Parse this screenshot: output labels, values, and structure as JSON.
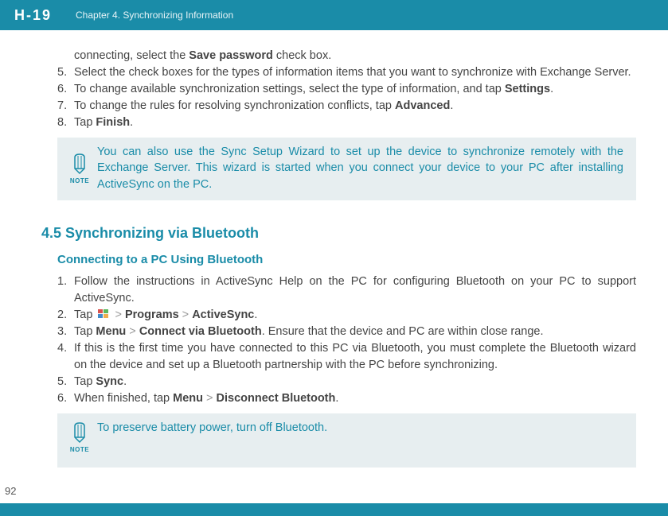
{
  "header": {
    "logo": "H-19",
    "chapter": "Chapter 4. Synchronizing Information"
  },
  "page_number": "92",
  "intro_line_prefix": "connecting, select the ",
  "intro_line_bold": "Save password",
  "intro_line_suffix": " check box.",
  "steps1": {
    "s5_num": "5.",
    "s5_txt": "Select the check boxes for the types of information items that you want to synchronize with Exchange Server.",
    "s6_num": "6.",
    "s6_a": "To change available synchronization settings, select the type of information, and tap ",
    "s6_b": "Settings",
    "s6_c": ".",
    "s7_num": "7.",
    "s7_a": "To change the rules for resolving synchronization conflicts, tap ",
    "s7_b": "Advanced",
    "s7_c": ".",
    "s8_num": "8.",
    "s8_a": "Tap ",
    "s8_b": "Finish",
    "s8_c": "."
  },
  "note1": "You can also use the Sync Setup Wizard to set up the device to synchronize remotely with the Exchange Server. This wizard is started when you connect your device to your PC after installing ActiveSync on the PC.",
  "note_label": "NOTE",
  "section_title": "4.5 Synchronizing via Bluetooth",
  "subsection": "Connecting to a PC Using Bluetooth",
  "steps2": {
    "s1_num": "1.",
    "s1_txt": "Follow the instructions in ActiveSync Help on the PC for configuring Bluetooth on your PC to support ActiveSync.",
    "s2_num": "2.",
    "s2_a": "Tap ",
    "s2_b": " > ",
    "s2_c": "Programs",
    "s2_d": " > ",
    "s2_e": "ActiveSync",
    "s2_f": ".",
    "s3_num": "3.",
    "s3_a": "Tap ",
    "s3_b": "Menu",
    "s3_c": " > ",
    "s3_d": "Connect via Bluetooth",
    "s3_e": ". Ensure that the device and PC are within close range.",
    "s4_num": "4.",
    "s4_txt": "If this is the first time you have connected to this PC via Bluetooth, you must complete the Bluetooth wizard on the device and set up a Bluetooth partnership with the PC before synchronizing.",
    "s5_num": "5.",
    "s5_a": "Tap ",
    "s5_b": "Sync",
    "s5_c": ".",
    "s6_num": "6.",
    "s6_a": "When finished, tap ",
    "s6_b": "Menu",
    "s6_c": " > ",
    "s6_d": "Disconnect Bluetooth",
    "s6_e": "."
  },
  "note2": "To preserve battery power, turn off Bluetooth."
}
